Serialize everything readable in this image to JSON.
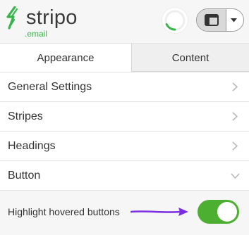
{
  "brand": {
    "name": "stripo",
    "domain": ".email",
    "logo_icon": "lightning-bolt-icon",
    "accent_color": "#37b54a"
  },
  "header": {
    "loading_icon": "spinner-icon",
    "view_icon": "panel-layout-icon",
    "dropdown_icon": "caret-down-icon"
  },
  "tabs": [
    {
      "label": "Appearance",
      "active": true
    },
    {
      "label": "Content",
      "active": false
    }
  ],
  "sections": [
    {
      "label": "General Settings",
      "expanded": false
    },
    {
      "label": "Stripes",
      "expanded": false
    },
    {
      "label": "Headings",
      "expanded": false
    },
    {
      "label": "Button",
      "expanded": true
    }
  ],
  "button_settings": {
    "highlight_label": "Highlight hovered buttons",
    "highlight_enabled": true,
    "toggle_color": "#4caf32",
    "annotation_arrow_color": "#7b2fe0"
  }
}
